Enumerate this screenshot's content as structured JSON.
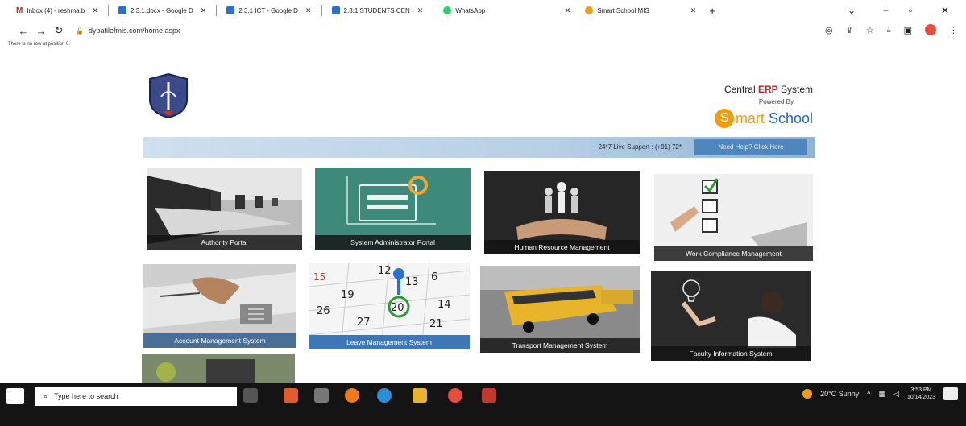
{
  "browser": {
    "tabs": [
      {
        "label": "Inbox (4) - reshma.b",
        "icon": "gmail-icon"
      },
      {
        "label": "2.3.1.docx - Google D",
        "icon": "docs-icon"
      },
      {
        "label": "2.3.1 ICT - Google D",
        "icon": "docs-icon"
      },
      {
        "label": "2.3.1 STUDENTS CEN",
        "icon": "docs-icon"
      },
      {
        "label": "WhatsApp",
        "icon": "whatsapp-icon"
      },
      {
        "label": "Smart School MIS",
        "icon": "smartschool-icon"
      }
    ],
    "new_tab": "+",
    "url": "dypatilefmis.com/home.aspx",
    "error_line": "There is no row at position 0."
  },
  "header": {
    "system_title_prefix": "Central ",
    "system_title_bold": "ERP",
    "system_title_suffix": " System",
    "powered_by": "Powered By",
    "brand_initial": "S",
    "brand_part1": "mart ",
    "brand_part2": "School"
  },
  "support": {
    "text": "24*7 Live Support : (+91) 72*",
    "button": "Need Help? Click Here"
  },
  "modules": [
    {
      "label": "Authority Portal"
    },
    {
      "label": "System Administrator Portal"
    },
    {
      "label": "Human Resource Management"
    },
    {
      "label": "Work Compliance Management"
    },
    {
      "label": "Account Management System"
    },
    {
      "label": "Leave Management System"
    },
    {
      "label": "Transport Management System"
    },
    {
      "label": "Faculty Information System"
    }
  ],
  "calendar_numbers": [
    "15",
    "12",
    "13",
    "6",
    "19",
    "20",
    "14",
    "26",
    "27",
    "21"
  ],
  "taskbar": {
    "search_placeholder": "Type here to search",
    "weather": "20°C  Sunny",
    "time": "3:53 PM",
    "date": "10/14/2023"
  },
  "colors": {
    "accent_blue": "#3d77b6",
    "brand_orange": "#f39c12",
    "strip_blue": "#b7d0e6"
  }
}
